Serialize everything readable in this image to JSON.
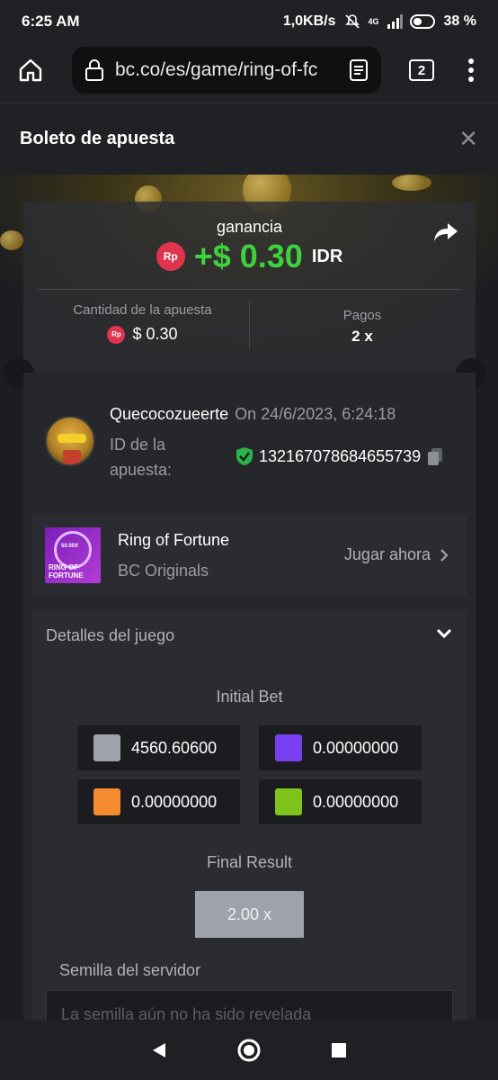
{
  "status": {
    "time": "6:25 AM",
    "speed": "1,0KB/s",
    "network": "4G",
    "battery": "38 %"
  },
  "browser": {
    "url": "bc.co/es/game/ring-of-fc",
    "tab_count": "2"
  },
  "header": {
    "title": "Boleto de apuesta"
  },
  "win": {
    "label": "ganancia",
    "amount": "+$ 0.30",
    "currency": "IDR",
    "badge": "Rp"
  },
  "bet_amount": {
    "label": "Cantidad de la apuesta",
    "value": "$ 0.30",
    "badge": "Rp"
  },
  "payout": {
    "label": "Pagos",
    "value": "2 x"
  },
  "user": {
    "name": "Quecocozueerte",
    "date": "On 24/6/2023, 6:24:18",
    "bet_id_label_1": "ID de la",
    "bet_id_label_2": "apuesta:",
    "bet_id": "132167078684655739"
  },
  "game": {
    "name": "Ring of Fortune",
    "provider": "BC Originals",
    "play_label": "Jugar ahora",
    "thumb_text_1": "RING OF",
    "thumb_text_2": "FORTUNE",
    "thumb_badge": "50.00X"
  },
  "details": {
    "title": "Detalles del juego",
    "initial_bet_label": "Initial Bet",
    "bets": [
      {
        "color": "#9ea3ab",
        "value": "4560.60600"
      },
      {
        "color": "#7b3ff2",
        "value": "0.00000000"
      },
      {
        "color": "#f58a2e",
        "value": "0.00000000"
      },
      {
        "color": "#7ec41c",
        "value": "0.00000000"
      }
    ],
    "final_result_label": "Final Result",
    "final_result": "2.00 x",
    "server_seed_label": "Semilla del servidor",
    "server_seed_placeholder": "La semilla aún no ha sido revelada"
  },
  "colors": {
    "win_green": "#3fd13f",
    "accent_red": "#e0334d"
  }
}
